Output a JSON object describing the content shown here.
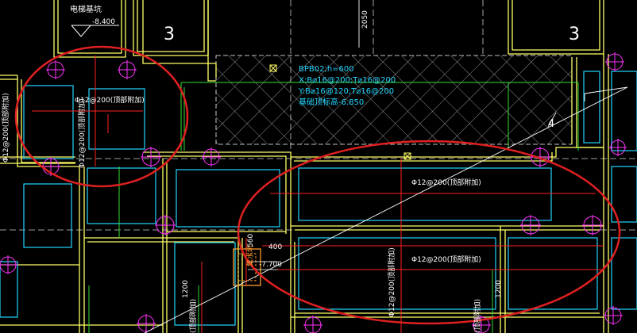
{
  "drawing": {
    "labels": {
      "elevator_pit": "电梯基坑",
      "pit_level": "-8.400",
      "grid_left": "3",
      "grid_right": "3",
      "dim_2050": "2050",
      "slab_mark_1": "BPB02;h=600",
      "slab_mark_2": "X:B⌀16@200;T⌀16@200",
      "slab_mark_3": "Y:B⌀16@120;T⌀16@200",
      "slab_mark_4": "基础顶标高-6.850",
      "rebar_top_h_left": "Φ12@200(顶部附加)",
      "rebar_top_v_left": "Φ12@200(顶部附加)",
      "rebar_top_v_left2": "Φ12@200(顶部附加)",
      "rebar_top_h_right": "Φ12@200(顶部附加)",
      "rebar_top_h_right2": "Φ12@200(顶部附加)",
      "rebar_top_v_right": "Φ12@200(顶部附加)",
      "rebar_bottom": "(顶部附加)",
      "rebar_bottom2": "(顶部附加)",
      "sump_pit": "集水坑",
      "sump_level": "-7.700",
      "dim_560": "560",
      "dim_400": "400",
      "dim_1200a": "1200",
      "dim_1200b": "1200",
      "dim_4": "4"
    },
    "colors": {
      "background": "#000000",
      "wall": "#ffff66",
      "cyan": "#23d6ff",
      "green": "#33dd33",
      "red_line": "#ff2020",
      "magenta": "#ff33ff",
      "callout": "#e02020",
      "white": "#ffffff",
      "orange": "#ff9a2e"
    }
  }
}
